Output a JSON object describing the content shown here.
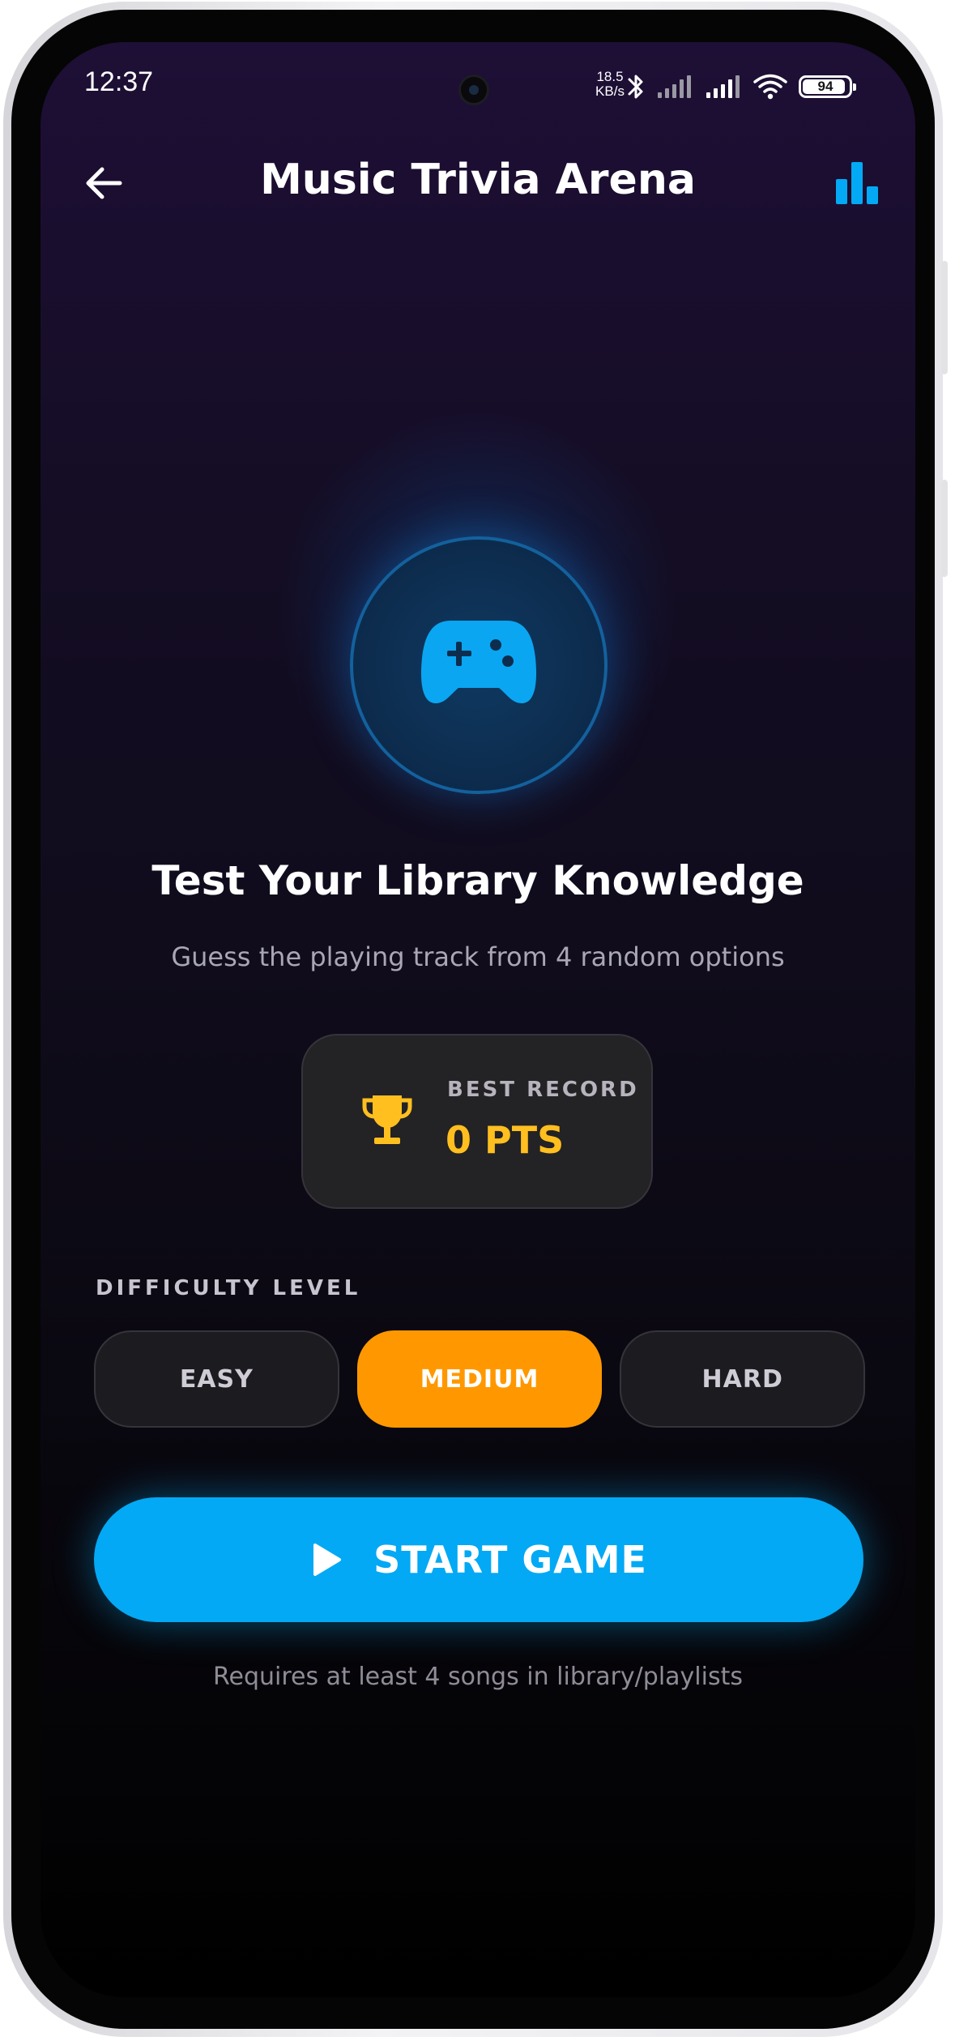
{
  "status_bar": {
    "time": "12:37",
    "net_speed_value": "18.5",
    "net_speed_unit": "KB/s",
    "battery": "94"
  },
  "header": {
    "title": "Music Trivia Arena",
    "back_icon": "arrow-left-icon",
    "stats_icon": "bar-chart-icon"
  },
  "hero": {
    "icon": "gamepad-icon",
    "heading": "Test Your Library Knowledge",
    "subheading": "Guess the playing track from 4 random options"
  },
  "best_record": {
    "label": "BEST RECORD",
    "value": "0 PTS",
    "icon": "trophy-icon"
  },
  "difficulty": {
    "label": "DIFFICULTY LEVEL",
    "options": [
      "EASY",
      "MEDIUM",
      "HARD"
    ],
    "selected": "MEDIUM"
  },
  "start_button": {
    "label": "START GAME",
    "icon": "play-icon"
  },
  "note": "Requires at least 4 songs in library/playlists",
  "colors": {
    "accent_blue": "#03a9f4",
    "accent_orange": "#ff9800",
    "record_gold": "#ffbf1f"
  }
}
